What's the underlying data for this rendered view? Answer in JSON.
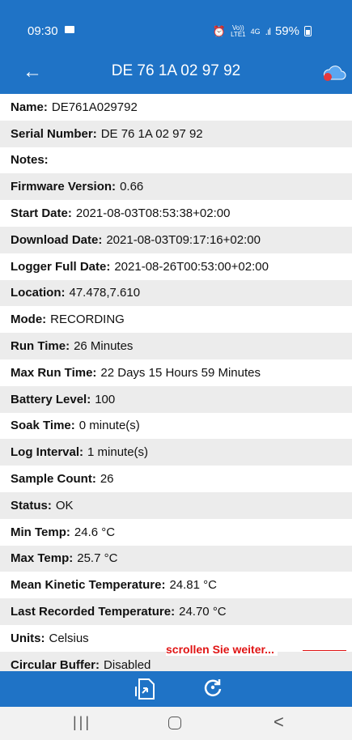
{
  "status_bar": {
    "time": "09:30",
    "network": "4G",
    "volte": "Vo)) LTE1",
    "battery": "59%"
  },
  "app_bar": {
    "title": "DE 76 1A 02 97 92"
  },
  "details": [
    {
      "label": "Name:",
      "value": "DE761A029792"
    },
    {
      "label": "Serial Number:",
      "value": "DE 76 1A 02 97 92"
    },
    {
      "label": "Notes:",
      "value": ""
    },
    {
      "label": "Firmware Version:",
      "value": "0.66"
    },
    {
      "label": "Start Date:",
      "value": "2021-08-03T08:53:38+02:00"
    },
    {
      "label": "Download Date:",
      "value": "2021-08-03T09:17:16+02:00"
    },
    {
      "label": "Logger Full Date:",
      "value": "2021-08-26T00:53:00+02:00"
    },
    {
      "label": "Location:",
      "value": "47.478,7.610"
    },
    {
      "label": "Mode:",
      "value": "RECORDING"
    },
    {
      "label": "Run Time:",
      "value": "26 Minutes"
    },
    {
      "label": "Max Run Time:",
      "value": "22 Days 15 Hours 59 Minutes"
    },
    {
      "label": "Battery Level:",
      "value": "100"
    },
    {
      "label": "Soak Time:",
      "value": "0 minute(s)"
    },
    {
      "label": "Log Interval:",
      "value": "1 minute(s)"
    },
    {
      "label": "Sample Count:",
      "value": "26"
    },
    {
      "label": "Status:",
      "value": "OK"
    },
    {
      "label": "Min Temp:",
      "value": "24.6 °C"
    },
    {
      "label": "Max Temp:",
      "value": "25.7 °C"
    },
    {
      "label": "Mean Kinetic Temperature:",
      "value": "24.81 °C"
    },
    {
      "label": "Last Recorded Temperature:",
      "value": "24.70 °C"
    },
    {
      "label": "Units:",
      "value": "Celsius"
    },
    {
      "label": "Circular Buffer:",
      "value": "Disabled"
    }
  ],
  "annotation": {
    "text": "scrollen Sie weiter..."
  },
  "colors": {
    "primary": "#1f73c6",
    "row_alt": "#ececec",
    "annotation": "#e01414"
  },
  "icons": {
    "back": "arrow-left-icon",
    "cloud": "cloud-icon",
    "export": "export-file-icon",
    "refresh": "refresh-icon"
  }
}
